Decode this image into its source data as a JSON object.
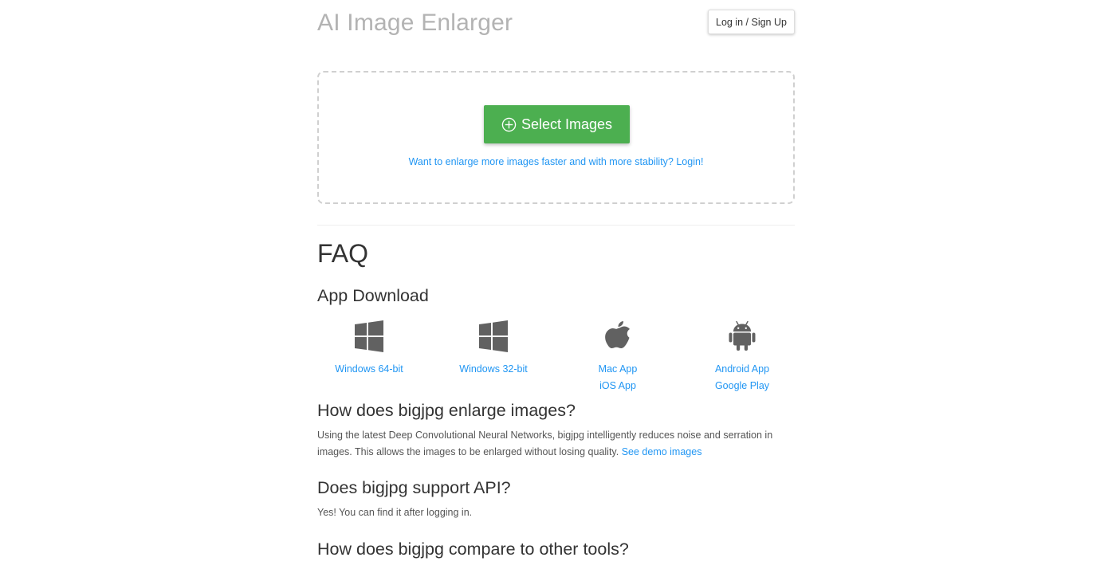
{
  "header": {
    "title": "AI Image Enlarger",
    "login_label": "Log in / Sign Up"
  },
  "upload": {
    "select_label": "Select Images",
    "upsell_text": "Want to enlarge more images faster and with more stability? Login!"
  },
  "faq": {
    "title": "FAQ",
    "app_download": {
      "heading": "App Download",
      "apps": [
        {
          "icon": "windows-icon",
          "links": [
            "Windows 64-bit"
          ]
        },
        {
          "icon": "windows-icon",
          "links": [
            "Windows 32-bit"
          ]
        },
        {
          "icon": "apple-icon",
          "links": [
            "Mac App",
            "iOS App"
          ]
        },
        {
          "icon": "android-icon",
          "links": [
            "Android App",
            "Google Play"
          ]
        }
      ]
    },
    "q1": {
      "heading": "How does bigjpg enlarge images?",
      "text": "Using the latest Deep Convolutional Neural Networks, bigjpg intelligently reduces noise and serration in images. This allows the images to be enlarged without losing quality.",
      "link": "See demo images"
    },
    "q2": {
      "heading": "Does bigjpg support API?",
      "text": "Yes! You can find it after logging in."
    },
    "q3": {
      "heading": "How does bigjpg compare to other tools?"
    }
  },
  "colors": {
    "accent_green": "#4caf50",
    "link_blue": "#2196f3",
    "icon_gray": "#616161"
  }
}
